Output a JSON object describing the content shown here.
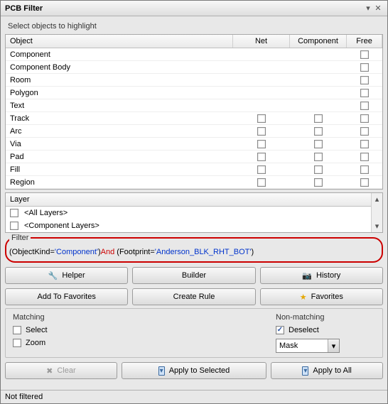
{
  "window": {
    "title": "PCB Filter"
  },
  "highlight": {
    "label": "Select objects to highlight",
    "headers": {
      "object": "Object",
      "net": "Net",
      "component": "Component",
      "free": "Free"
    },
    "rows": [
      {
        "name": "Component",
        "net": false,
        "component": false,
        "free": true
      },
      {
        "name": "Component Body",
        "net": false,
        "component": false,
        "free": true
      },
      {
        "name": "Room",
        "net": false,
        "component": false,
        "free": true
      },
      {
        "name": "Polygon",
        "net": false,
        "component": false,
        "free": true
      },
      {
        "name": "Text",
        "net": false,
        "component": false,
        "free": true
      },
      {
        "name": "Track",
        "net": true,
        "component": true,
        "free": true
      },
      {
        "name": "Arc",
        "net": true,
        "component": true,
        "free": true
      },
      {
        "name": "Via",
        "net": true,
        "component": true,
        "free": true
      },
      {
        "name": "Pad",
        "net": true,
        "component": true,
        "free": true
      },
      {
        "name": "Fill",
        "net": true,
        "component": true,
        "free": true
      },
      {
        "name": "Region",
        "net": true,
        "component": true,
        "free": true
      }
    ]
  },
  "layers": {
    "header": "Layer",
    "items": [
      {
        "label": "<All Layers>"
      },
      {
        "label": "<Component Layers>"
      }
    ]
  },
  "filter": {
    "legend": "Filter",
    "parts": {
      "p1": "(ObjectKind=",
      "p2": "'Component'",
      "p3": ")",
      "p4": "And",
      "p5": " (Footprint=",
      "p6": "'Anderson_BLK_RHT_BOT'",
      "p7": ")"
    }
  },
  "buttons": {
    "helper": "Helper",
    "builder": "Builder",
    "history": "History",
    "add_fav": "Add To Favorites",
    "create_rule": "Create Rule",
    "favorites": "Favorites",
    "clear": "Clear",
    "apply_sel": "Apply to Selected",
    "apply_all": "Apply to All"
  },
  "matching": {
    "title": "Matching",
    "select": "Select",
    "zoom": "Zoom"
  },
  "nonmatching": {
    "title": "Non-matching",
    "deselect": "Deselect",
    "deselect_checked": true,
    "mask_value": "Mask"
  },
  "status": {
    "text": "Not filtered"
  }
}
